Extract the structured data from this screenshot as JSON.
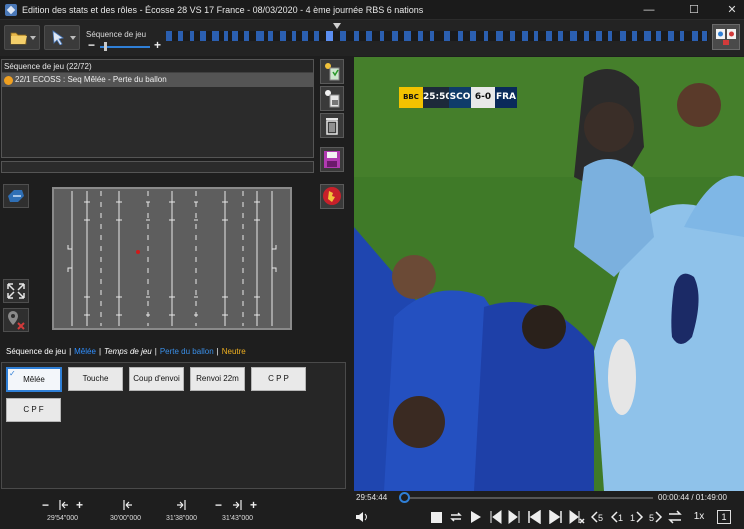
{
  "window": {
    "title": "Edition des stats et des rôles - Écosse 28 VS 17 France - 08/03/2020 - 4 ème journée RBS 6 nations",
    "minimize": "—",
    "maximize": "☐",
    "close": "✕"
  },
  "toolbar": {
    "sequence_label": "Séquence de jeu",
    "zoom_minus": "−",
    "zoom_plus": "+"
  },
  "sequence_panel": {
    "header": "Séquence de jeu (22/72)",
    "rows": [
      {
        "label": "22/1 ECOSS : Seq Mêlée - Perte du ballon",
        "status_color": "#f0a020"
      }
    ]
  },
  "legend": [
    {
      "text": "Séquence de jeu",
      "color": "#ffffff",
      "italic": false
    },
    {
      "text": "|",
      "color": "#ffffff",
      "italic": false
    },
    {
      "text": "Mêlée",
      "color": "#2f8fff",
      "italic": false
    },
    {
      "text": "|",
      "color": "#ffffff",
      "italic": false
    },
    {
      "text": "Temps de jeu",
      "color": "#ffffff",
      "italic": true
    },
    {
      "text": "|",
      "color": "#ffffff",
      "italic": false
    },
    {
      "text": "Perte du ballon",
      "color": "#3a8fe8",
      "italic": false
    },
    {
      "text": "|",
      "color": "#ffffff",
      "italic": false
    },
    {
      "text": "Neutre",
      "color": "#f0b020",
      "italic": false
    }
  ],
  "action_buttons": {
    "melee": "Mêlée",
    "touche": "Touche",
    "coup_envoi": "Coup d'envoi",
    "renvoi_22m": "Renvoi 22m",
    "cpp": "C P P",
    "cpf": "C P F",
    "selected_check": "✓"
  },
  "timers": {
    "minus": "−",
    "plus": "+",
    "t1": "29'54\"000",
    "t2": "30'00\"000",
    "t3": "31'38\"000",
    "t4": "31'43\"000"
  },
  "video": {
    "broadcaster": "BBC",
    "clock": "25:50",
    "team1": "SCO",
    "score": "6-0",
    "team2": "FRA"
  },
  "player": {
    "current_time": "29:54:44",
    "position_label": "00:00:44 / 01:49:00",
    "position_fraction": 0.007,
    "speed": "1x",
    "step": "1"
  },
  "colors": {
    "accent": "#2f7fd6",
    "timeline_tick": "#2b5fb0",
    "timeline_highlight": "#5b8ef0"
  },
  "icons": [
    "open-folder-icon",
    "cursor-tool-icon",
    "add-stat-icon",
    "lock-stat-icon",
    "trash-icon",
    "save-icon",
    "team-crest-icon",
    "expand-icon",
    "remove-marker-icon",
    "sequence-icon"
  ]
}
